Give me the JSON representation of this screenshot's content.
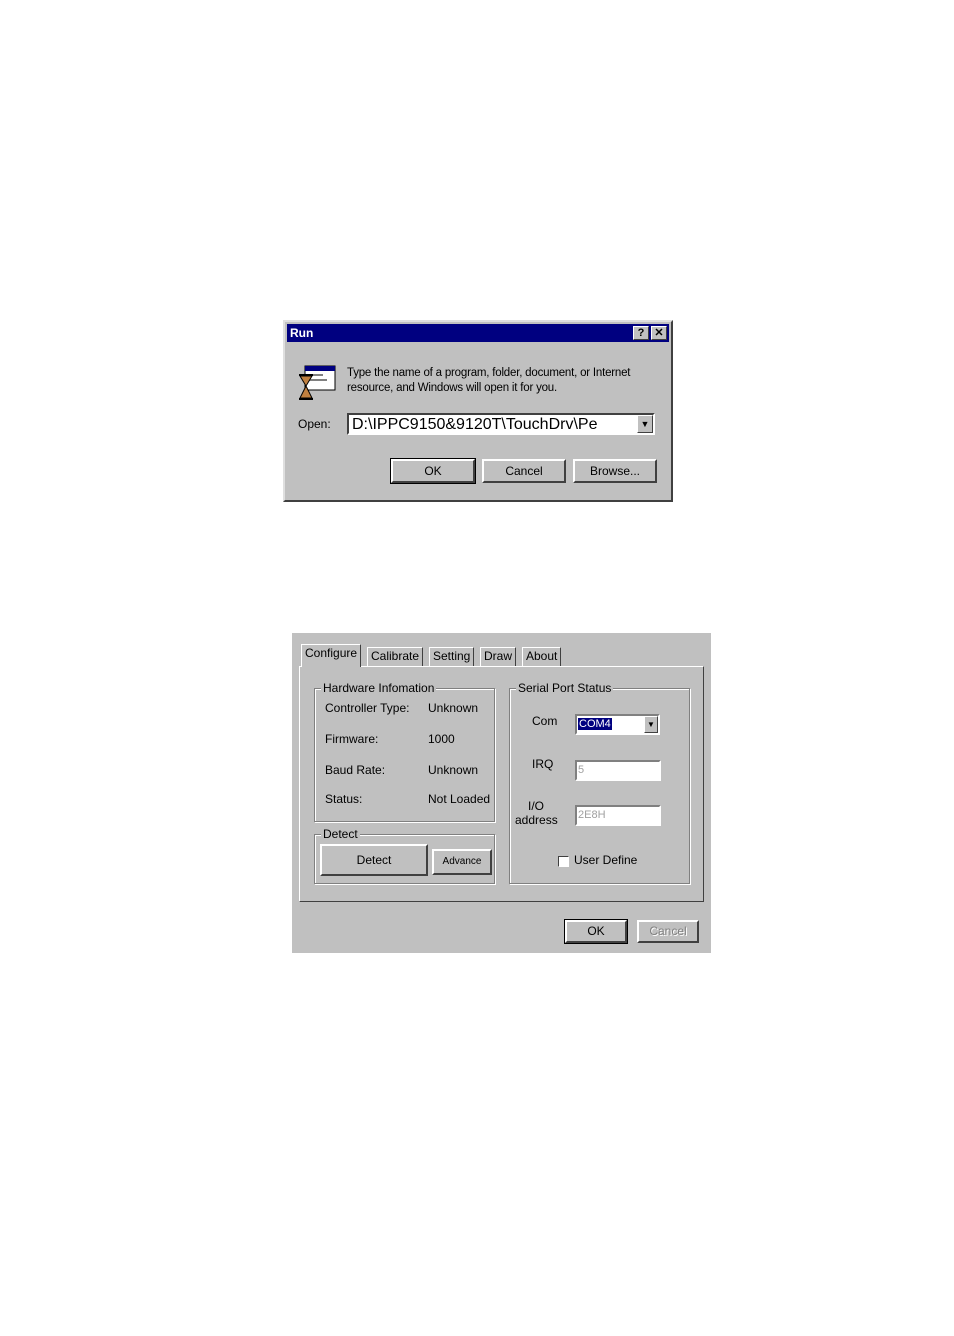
{
  "run_dialog": {
    "title": "Run",
    "help_button": "?",
    "close_button": "✕",
    "description": "Type the name of a program, folder, document, or Internet resource, and Windows will open it for you.",
    "open_label": "Open:",
    "open_value": "D:\\IPPC9150&9120T\\TouchDrv\\Pe",
    "ok_label": "OK",
    "cancel_label": "Cancel",
    "browse_label": "Browse..."
  },
  "touch_panel": {
    "tabs": [
      "Configure",
      "Calibrate",
      "Setting",
      "Draw",
      "About"
    ],
    "hardware_info": {
      "group_label": "Hardware Infomation",
      "rows": [
        {
          "label": "Controller Type:",
          "value": "Unknown"
        },
        {
          "label": "Firmware:",
          "value": "1000"
        },
        {
          "label": "Baud Rate:",
          "value": "Unknown"
        },
        {
          "label": "Status:",
          "value": "Not Loaded"
        }
      ]
    },
    "detect": {
      "group_label": "Detect",
      "detect_button": "Detect",
      "advance_button": "Advance"
    },
    "serial_port": {
      "group_label": "Serial Port Status",
      "com_label": "Com",
      "com_value": "COM4",
      "irq_label": "IRQ",
      "irq_value": "5",
      "io_label_line1": "I/O",
      "io_label_line2": "address",
      "io_value": "2E8H",
      "user_define_label": "User Define",
      "user_define_checked": false
    },
    "ok_label": "OK",
    "cancel_label": "Cancel"
  }
}
